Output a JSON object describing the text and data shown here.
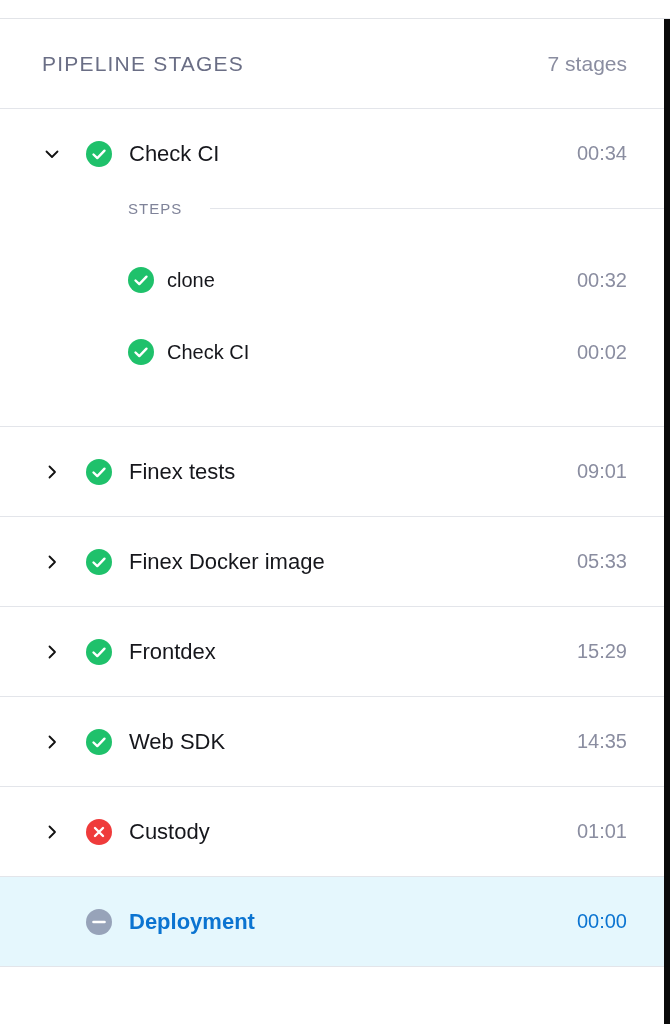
{
  "header": {
    "title": "PIPELINE STAGES",
    "count": "7 stages"
  },
  "stages": [
    {
      "name": "Check CI",
      "time": "00:34",
      "kind": "success",
      "expanded": true,
      "selected": false,
      "steps_label": "STEPS",
      "steps": [
        {
          "name": "clone",
          "time": "00:32",
          "kind": "success"
        },
        {
          "name": "Check CI",
          "time": "00:02",
          "kind": "success"
        }
      ]
    },
    {
      "name": "Finex tests",
      "time": "09:01",
      "kind": "success",
      "expanded": false,
      "selected": false
    },
    {
      "name": "Finex Docker image",
      "time": "05:33",
      "kind": "success",
      "expanded": false,
      "selected": false
    },
    {
      "name": "Frontdex",
      "time": "15:29",
      "kind": "success",
      "expanded": false,
      "selected": false
    },
    {
      "name": "Web SDK",
      "time": "14:35",
      "kind": "success",
      "expanded": false,
      "selected": false
    },
    {
      "name": "Custody",
      "time": "01:01",
      "kind": "failed",
      "expanded": false,
      "selected": false
    },
    {
      "name": "Deployment",
      "time": "00:00",
      "kind": "skipped",
      "selected": true
    }
  ]
}
